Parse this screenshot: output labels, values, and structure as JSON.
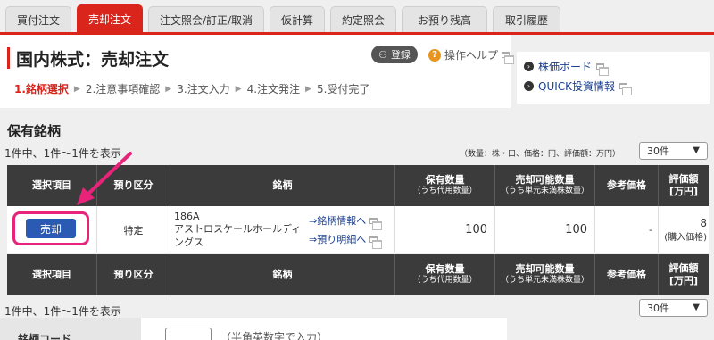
{
  "tabs": [
    {
      "label": "買付注文"
    },
    {
      "label": "売却注文"
    },
    {
      "label": "注文照会/訂正/取消"
    },
    {
      "label": "仮計算"
    },
    {
      "label": "約定照会"
    },
    {
      "label": "お預り残高"
    },
    {
      "label": "取引履歴"
    }
  ],
  "header": {
    "title": "国内株式：売却注文",
    "register_label": "登録",
    "help_label": "操作ヘルプ",
    "steps": [
      "1.銘柄選択",
      "2.注意事項確認",
      "3.注文入力",
      "4.注文発注",
      "5.受付完了"
    ]
  },
  "side_links": [
    "株価ボード",
    "QUICK投資情報"
  ],
  "holdings": {
    "section_title": "保有銘柄",
    "count_top": "1件中、1件〜1件を表示",
    "count_bottom": "1件中、1件〜1件を表示",
    "units": "（数量：株・口、価格：円、評価額：万円）",
    "per_page": "30件",
    "columns": [
      {
        "main": "選択項目",
        "sub": ""
      },
      {
        "main": "預り区分",
        "sub": ""
      },
      {
        "main": "銘柄",
        "sub": ""
      },
      {
        "main": "保有数量",
        "sub": "（うち代用数量）"
      },
      {
        "main": "売却可能数量",
        "sub": "（うち単元未満株数量）"
      },
      {
        "main": "参考価格",
        "sub": ""
      },
      {
        "main": "評価額",
        "sub": "[万円]"
      }
    ],
    "row": {
      "sell_label": "売却",
      "account_type": "特定",
      "code": "186A",
      "name": "アストロスケールホールディングス",
      "link_info": "⇒銘柄情報へ",
      "link_detail": "⇒預り明細へ",
      "quantity": "100",
      "sellable": "100",
      "ref_price": "-",
      "valuation": "8",
      "valuation_note": "(購入価格)"
    }
  },
  "form": {
    "code_label": "銘柄コード",
    "code_hint": "（半角英数字で入力）"
  },
  "colors": {
    "accent": "#d9251c",
    "button_blue": "#2a5ab3",
    "highlight_pink": "#e8237a",
    "header_dark": "#3b3b3b"
  }
}
